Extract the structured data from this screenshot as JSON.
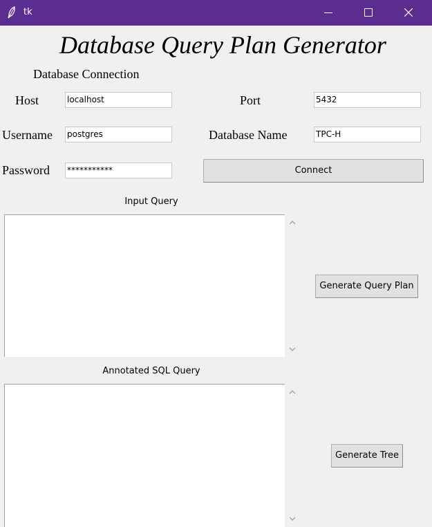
{
  "window": {
    "title": "tk",
    "accent": "#5c2d91"
  },
  "app": {
    "title": "Database Query Plan Generator"
  },
  "connection": {
    "section_label": "Database Connection",
    "host_label": "Host",
    "host_value": "localhost",
    "port_label": "Port",
    "port_value": "5432",
    "username_label": "Username",
    "username_value": "postgres",
    "dbname_label": "Database Name",
    "dbname_value": "TPC-H",
    "password_label": "Password",
    "password_value": "***********",
    "connect_button": "Connect"
  },
  "input_query": {
    "label": "Input Query",
    "value": ""
  },
  "annotated_query": {
    "label": "Annotated SQL Query",
    "value": ""
  },
  "actions": {
    "generate_plan": "Generate Query Plan",
    "generate_tree": "Generate Tree"
  },
  "icons": [
    "feather-icon",
    "minimize-icon",
    "maximize-icon",
    "close-icon",
    "scroll-up-icon",
    "scroll-down-icon"
  ]
}
